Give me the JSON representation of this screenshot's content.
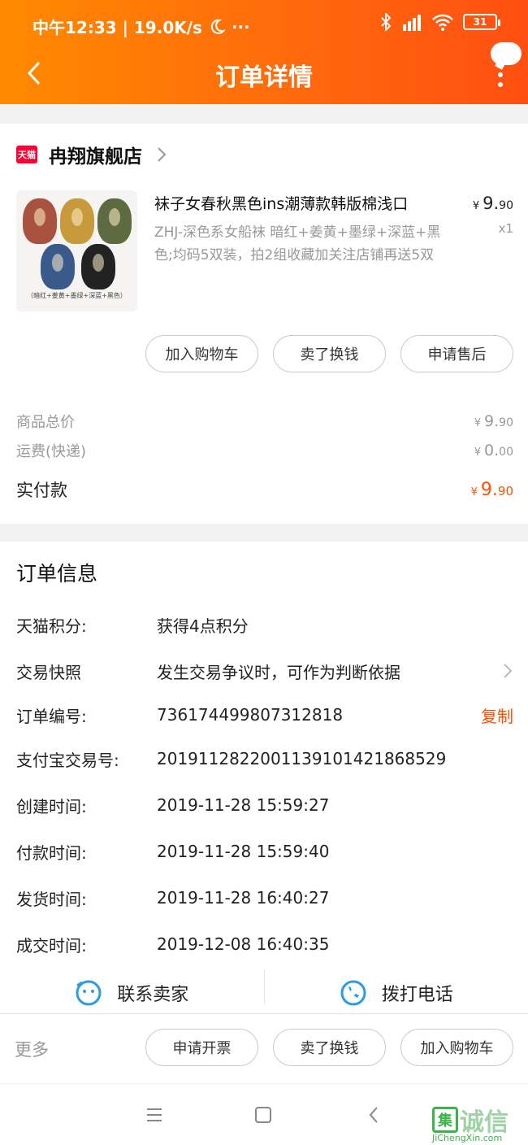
{
  "statusbar": {
    "time": "中午12:33 | 19.0K/s",
    "dots": "···",
    "battery": "31"
  },
  "header": {
    "title": "订单详情"
  },
  "shop": {
    "badge": "天猫",
    "name": "冉翔旗舰店"
  },
  "product": {
    "thumb_caption": "（暗红+姜黄+墨绿+深蓝+黑色）",
    "title": "袜子女春秋黑色ins潮薄款韩版棉浅口",
    "sku": "ZHJ-深色系女船袜 暗红+姜黄+墨绿+深蓝+黑色;均码5双装，拍2组收藏加关注店铺再送5双",
    "price_yen": "¥",
    "price_int": "9.",
    "price_dec": "90",
    "qty": "x1",
    "sock_colors": [
      "#a8523f",
      "#c79a3c",
      "#5e6a3f",
      "#3b5a8c",
      "#222222"
    ]
  },
  "item_actions": [
    "加入购物车",
    "卖了换钱",
    "申请售后"
  ],
  "price_summary": {
    "goods_label": "商品总价",
    "goods_yen": "¥",
    "goods_int": "9.",
    "goods_dec": "90",
    "shipping_label": "运费(快递)",
    "shipping_yen": "¥",
    "shipping_int": "0.",
    "shipping_dec": "00",
    "paid_label": "实付款",
    "paid_yen": "¥",
    "paid_int": "9.",
    "paid_dec": "90"
  },
  "order_info": {
    "title": "订单信息",
    "rows": [
      {
        "label": "天猫积分:",
        "value": "获得4点积分"
      },
      {
        "label": "交易快照",
        "value": "发生交易争议时，可作为判断依据"
      },
      {
        "label": "订单编号:",
        "value": "736174499807312818"
      },
      {
        "label": "支付宝交易号:",
        "value": "2019112822001139101421868529"
      },
      {
        "label": "创建时间:",
        "value": "2019-11-28 15:59:27"
      },
      {
        "label": "付款时间:",
        "value": "2019-11-28 15:59:40"
      },
      {
        "label": "发货时间:",
        "value": "2019-11-28 16:40:27"
      },
      {
        "label": "成交时间:",
        "value": "2019-12-08 16:40:35"
      }
    ],
    "copy_label": "复制"
  },
  "contact": {
    "seller": "联系卖家",
    "phone": "拨打电话"
  },
  "bottom_bar": {
    "more": "更多",
    "actions": [
      "申请开票",
      "卖了换钱",
      "加入购物车"
    ]
  },
  "watermark": {
    "box": "集",
    "text": "诚信",
    "url": "JiChengXin.com"
  },
  "colors": {
    "accent": "#ff5000",
    "header_start": "#ff8a00",
    "header_end": "#ff4f12",
    "tmall_red": "#ff0036",
    "contact_blue": "#2b9be8"
  }
}
